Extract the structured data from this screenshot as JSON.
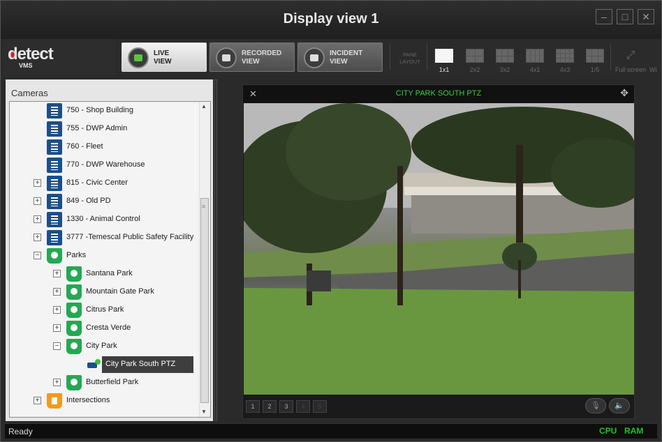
{
  "window": {
    "title": "Display view 1"
  },
  "logo": {
    "brand": "detect",
    "sub": "VMS"
  },
  "nav": [
    {
      "label": "LIVE\nVIEW",
      "active": true,
      "icon": "video-camera-icon"
    },
    {
      "label": "RECORDED\nVIEW",
      "active": false,
      "icon": "film-camera-icon"
    },
    {
      "label": "INCIDENT\nVIEW",
      "active": false,
      "icon": "incident-camera-icon"
    }
  ],
  "pane_layout": {
    "label": "PANE\nLAYOUT",
    "options": [
      {
        "cap": "1x1",
        "cols": 1,
        "rows": 1,
        "selected": true
      },
      {
        "cap": "2x2",
        "cols": 2,
        "rows": 2,
        "selected": false
      },
      {
        "cap": "3x2",
        "cols": 3,
        "rows": 2,
        "selected": false
      },
      {
        "cap": "4x1",
        "cols": 4,
        "rows": 1,
        "selected": false
      },
      {
        "cap": "4x3",
        "cols": 4,
        "rows": 3,
        "selected": false
      },
      {
        "cap": "1/5",
        "cols": 3,
        "rows": 2,
        "selected": false
      }
    ],
    "fullscreen": "Full screen",
    "extra": "Wi"
  },
  "cameras": {
    "header": "Cameras",
    "rows": [
      {
        "label": "750 - Shop Building",
        "icon": "building",
        "depth": 1,
        "expander": ""
      },
      {
        "label": "755 - DWP Admin",
        "icon": "building",
        "depth": 1,
        "expander": ""
      },
      {
        "label": "760 - Fleet",
        "icon": "building",
        "depth": 1,
        "expander": ""
      },
      {
        "label": "770 - DWP Warehouse",
        "icon": "building",
        "depth": 1,
        "expander": ""
      },
      {
        "label": "815 - Civic Center",
        "icon": "building",
        "depth": 1,
        "expander": "+"
      },
      {
        "label": "849 - Old PD",
        "icon": "building",
        "depth": 1,
        "expander": "+"
      },
      {
        "label": "1330 - Animal Control",
        "icon": "building",
        "depth": 1,
        "expander": "+"
      },
      {
        "label": "3777 -Temescal Public Safety Facility",
        "icon": "building",
        "depth": 1,
        "expander": "+"
      },
      {
        "label": "Parks",
        "icon": "park",
        "depth": 1,
        "expander": "−"
      },
      {
        "label": "Santana Park",
        "icon": "park",
        "depth": 2,
        "expander": "+"
      },
      {
        "label": "Mountain Gate Park",
        "icon": "park",
        "depth": 2,
        "expander": "+"
      },
      {
        "label": "Citrus Park",
        "icon": "park",
        "depth": 2,
        "expander": "+"
      },
      {
        "label": "Cresta Verde",
        "icon": "park",
        "depth": 2,
        "expander": "+"
      },
      {
        "label": "City Park",
        "icon": "park",
        "depth": 2,
        "expander": "−"
      },
      {
        "label": "City Park South PTZ",
        "icon": "camera",
        "depth": 3,
        "expander": "",
        "selected": true
      },
      {
        "label": "Butterfield Park",
        "icon": "park",
        "depth": 2,
        "expander": "+"
      },
      {
        "label": "Intersections",
        "icon": "intersection",
        "depth": 1,
        "expander": "+"
      }
    ]
  },
  "viewer": {
    "title": "CITY PARK SOUTH PTZ",
    "presets": [
      "1",
      "2",
      "3",
      "4",
      "5"
    ],
    "title_color": "#34d13a"
  },
  "status": {
    "text": "Ready",
    "cpu": "CPU",
    "ram": "RAM",
    "indicator_color": "#22c022"
  }
}
